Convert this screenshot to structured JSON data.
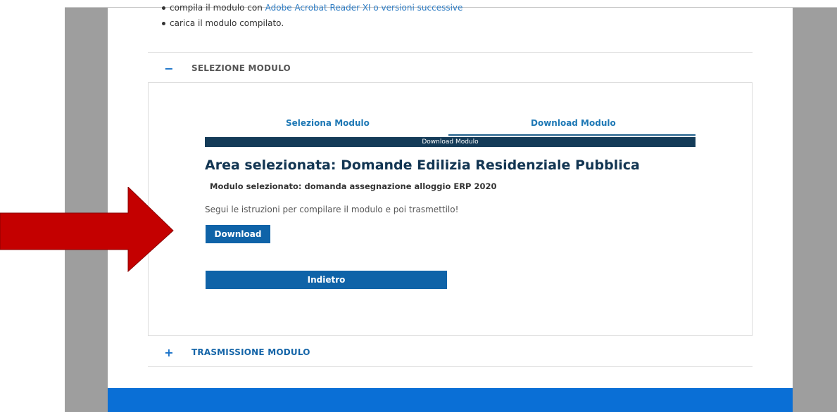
{
  "instructions_list": {
    "item1_prefix": "compila il modulo con ",
    "item1_link": "Adobe Acrobat Reader XI o versioni successive",
    "item2": "carica il modulo compilato."
  },
  "accordion": {
    "selezione": {
      "sign": "−",
      "title": "SELEZIONE MODULO",
      "title_color": "#555555"
    },
    "trasmissione": {
      "sign": "+",
      "title": "TRASMISSIONE MODULO",
      "title_color": "#1565a8"
    }
  },
  "tabs": {
    "select_label": "Seleziona Modulo",
    "download_label": "Download Modulo"
  },
  "progress": {
    "label": "Download Modulo"
  },
  "selection": {
    "area_title": "Area selezionata: Domande Edilizia Residenziale Pubblica",
    "module_selected": "Modulo selezionato: domanda assegnazione alloggio ERP 2020",
    "instructions": "Segui le istruzioni per compilare il modulo e poi trasmettilo!"
  },
  "buttons": {
    "download_label": "Download",
    "back_label": "Indietro"
  },
  "colors": {
    "accent_blue": "#0f63a8",
    "progress_bar": "#143b58",
    "footer": "#0a6fd6",
    "arrow": "#c40000"
  }
}
